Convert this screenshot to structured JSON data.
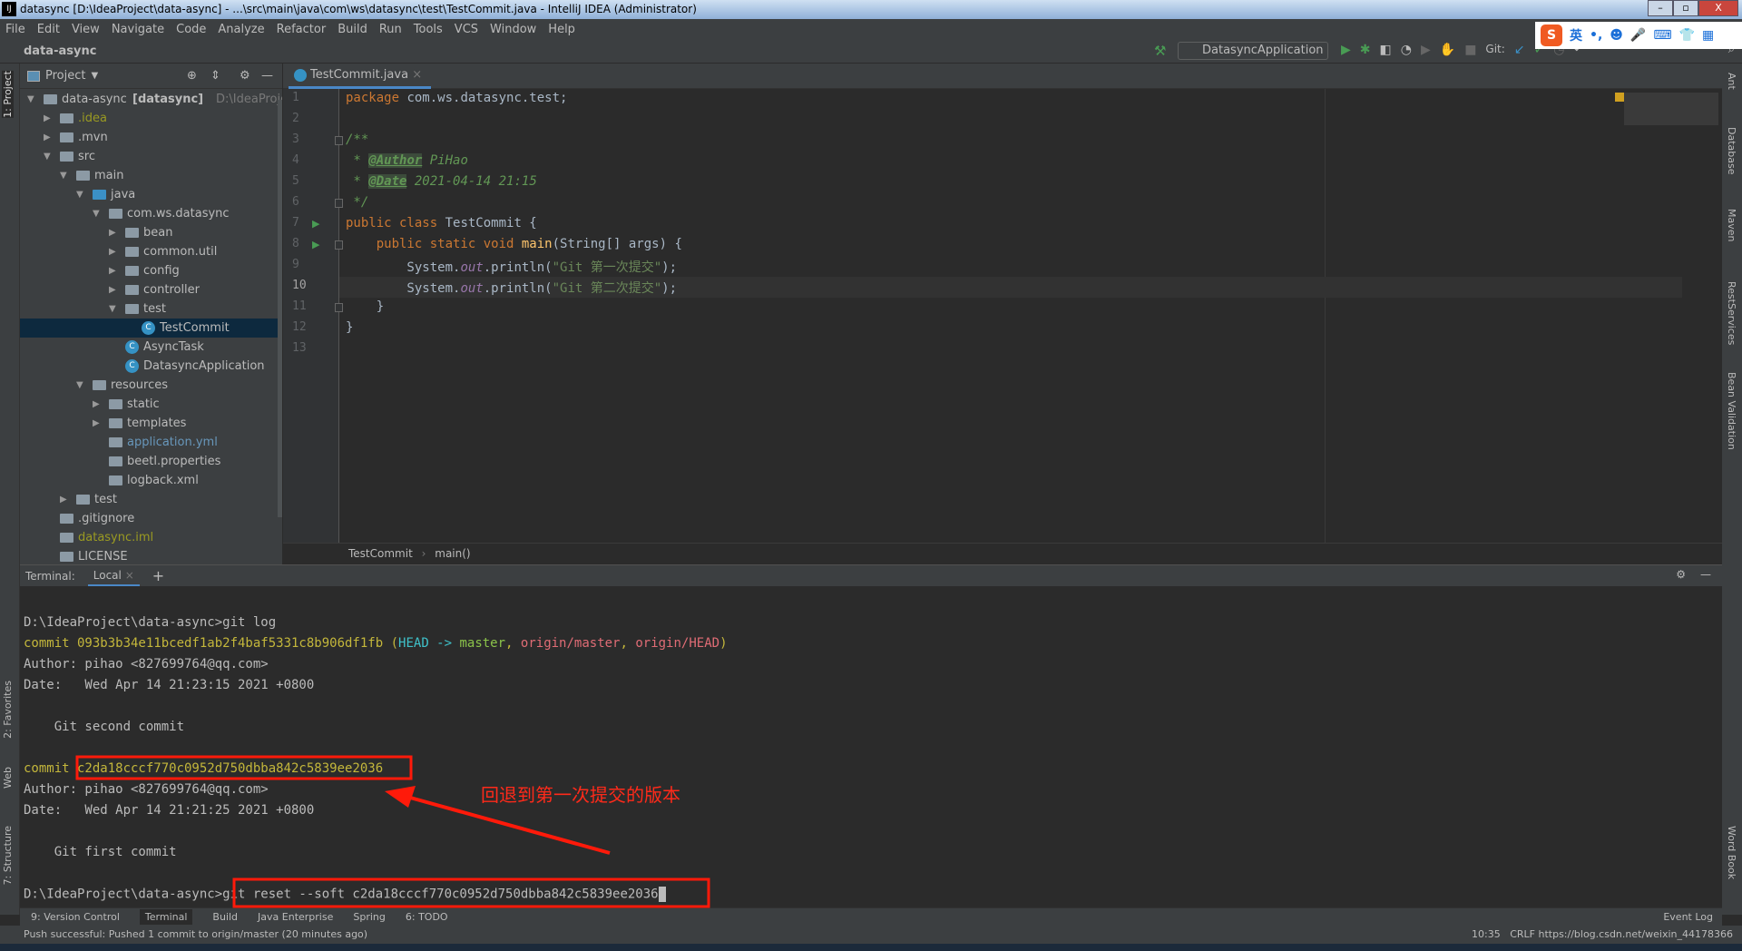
{
  "window": {
    "title": "datasync [D:\\IdeaProject\\data-async] - ...\\src\\main\\java\\com\\ws\\datasync\\test\\TestCommit.java - IntelliJ IDEA (Administrator)",
    "app_logo": "IJ",
    "minimize": "–",
    "restore": "▫",
    "close": "X"
  },
  "menu": [
    "File",
    "Edit",
    "View",
    "Navigate",
    "Code",
    "Analyze",
    "Refactor",
    "Build",
    "Run",
    "Tools",
    "VCS",
    "Window",
    "Help"
  ],
  "navbar": {
    "project": "data-async",
    "run_config": "DatasyncApplication",
    "git_label": "Git:"
  },
  "ime": {
    "logo": "S",
    "items": [
      "英",
      "•,",
      "☻",
      "🎤",
      "⌨",
      "👕",
      "▦"
    ]
  },
  "project_panel": {
    "title": "Project",
    "tree": [
      {
        "label": "data-async",
        "bold": " [datasync]",
        "hint": "D:\\IdeaProject\\data-async",
        "depth": 0,
        "arrow": "▼",
        "icon": "module"
      },
      {
        "label": ".idea",
        "depth": 1,
        "arrow": "▶",
        "icon": "folder",
        "color": "olive"
      },
      {
        "label": ".mvn",
        "depth": 1,
        "arrow": "▶",
        "icon": "folder"
      },
      {
        "label": "src",
        "depth": 1,
        "arrow": "▼",
        "icon": "folder"
      },
      {
        "label": "main",
        "depth": 2,
        "arrow": "▼",
        "icon": "folder"
      },
      {
        "label": "java",
        "depth": 3,
        "arrow": "▼",
        "icon": "folder-blue"
      },
      {
        "label": "com.ws.datasync",
        "depth": 4,
        "arrow": "▼",
        "icon": "package"
      },
      {
        "label": "bean",
        "depth": 5,
        "arrow": "▶",
        "icon": "package"
      },
      {
        "label": "common.util",
        "depth": 5,
        "arrow": "▶",
        "icon": "package"
      },
      {
        "label": "config",
        "depth": 5,
        "arrow": "▶",
        "icon": "package"
      },
      {
        "label": "controller",
        "depth": 5,
        "arrow": "▶",
        "icon": "package"
      },
      {
        "label": "test",
        "depth": 5,
        "arrow": "▼",
        "icon": "package"
      },
      {
        "label": "TestCommit",
        "depth": 6,
        "icon": "class",
        "selected": true
      },
      {
        "label": "AsyncTask",
        "depth": 5,
        "icon": "class"
      },
      {
        "label": "DatasyncApplication",
        "depth": 5,
        "icon": "class"
      },
      {
        "label": "resources",
        "depth": 3,
        "arrow": "▼",
        "icon": "folder"
      },
      {
        "label": "static",
        "depth": 4,
        "arrow": "▶",
        "icon": "package"
      },
      {
        "label": "templates",
        "depth": 4,
        "arrow": "▶",
        "icon": "package"
      },
      {
        "label": "application.yml",
        "depth": 4,
        "icon": "yml",
        "color": "link"
      },
      {
        "label": "beetl.properties",
        "depth": 4,
        "icon": "props"
      },
      {
        "label": "logback.xml",
        "depth": 4,
        "icon": "xml"
      },
      {
        "label": "test",
        "depth": 2,
        "arrow": "▶",
        "icon": "folder"
      },
      {
        "label": ".gitignore",
        "depth": 1,
        "icon": "file"
      },
      {
        "label": "datasync.iml",
        "depth": 1,
        "icon": "file",
        "color": "olive"
      },
      {
        "label": "LICENSE",
        "depth": 1,
        "icon": "file"
      }
    ]
  },
  "editor": {
    "tab": "TestCommit.java",
    "current_line": 10,
    "lines": [
      "<span class='kw'>package</span> com.ws.datasync.test;",
      "",
      "<span class='cm'>/**</span>",
      "<span class='cm'> * </span><span class='tag'>@Author</span><span class='cm'> PiHao</span>",
      "<span class='cm'> * </span><span class='tag'>@Date</span><span class='cm'> 2021-04-14 21:15</span>",
      "<span class='cm'> */</span>",
      "<span class='kw'>public class</span> TestCommit {",
      "    <span class='kw'>public static void</span> <span class='fn'>main</span>(String[] args) {",
      "        System.<span class='fld'>out</span>.println(<span class='st'>\"Git 第一次提交\"</span>);",
      "        System.<span class='fld'>out</span>.println(<span class='st'>\"Git 第二次提交\"</span>);",
      "    }",
      "}",
      ""
    ],
    "breadcrumb": [
      "TestCommit",
      "main()"
    ]
  },
  "terminal": {
    "label": "Terminal:",
    "tab": "Local",
    "add": "+",
    "lines": [
      "D:\\IdeaProject\\data-async>git log",
      "<span class='y'>commit 093b3b34e11bcedf1ab2f4baf5331c8b906df1fb</span> <span class='y'>(</span><span class='cy'>HEAD -> </span><span class='gr'>master</span><span class='y'>, </span><span class='rd'>origin/master</span><span class='y'>, </span><span class='rd'>origin/HEAD</span><span class='y'>)</span>",
      "Author: pihao <827699764@qq.com>",
      "Date:   Wed Apr 14 21:23:15 2021 +0800",
      "",
      "    Git second commit",
      "",
      "<span class='y'>commit c2da18cccf770c0952d750dbba842c5839ee2036</span>",
      "Author: pihao <827699764@qq.com>",
      "Date:   Wed Apr 14 21:21:25 2021 +0800",
      "",
      "    Git first commit",
      "",
      "D:\\IdeaProject\\data-async>git reset --soft c2da18cccf770c0952d750dbba842c5839ee2036<span class='cursor'></span>"
    ],
    "annotation": "回退到第一次提交的版本"
  },
  "bottom_tools": [
    "9: Version Control",
    "Terminal",
    "Build",
    "Java Enterprise",
    "Spring",
    "6: TODO",
    "Event Log"
  ],
  "left_stripe": [
    "1: Project",
    "2: Favorites",
    "Web",
    "7: Structure"
  ],
  "right_stripe": [
    "Ant",
    "Database",
    "Maven",
    "RestServices",
    "Bean Validation",
    "Word Book"
  ],
  "status": {
    "message": "Push successful: Pushed 1 commit to origin/master (20 minutes ago)",
    "position": "10:35",
    "line_sep": "CRLF",
    "watermark": "https://blog.csdn.net/weixin_44178366"
  },
  "colors": {
    "annotation": "#ff2a1a",
    "accent": "#4a88c7"
  }
}
